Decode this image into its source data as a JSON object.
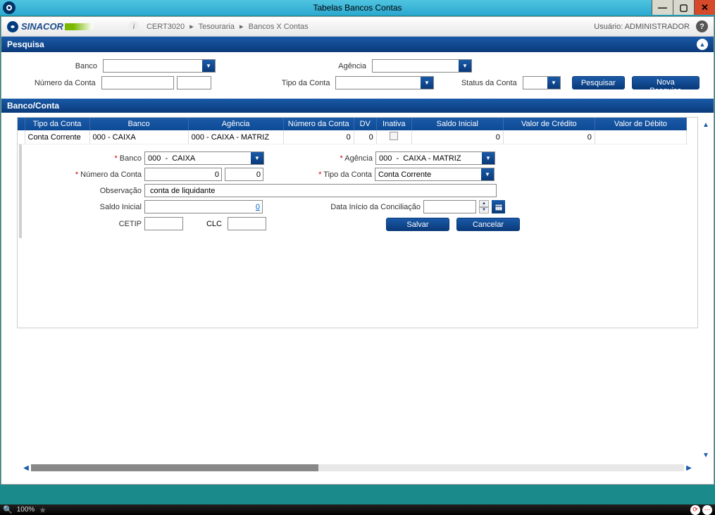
{
  "window": {
    "title": "Tabelas Bancos Contas"
  },
  "appbar": {
    "brand": "SINACOR",
    "breadcrumb": {
      "env": "CERT3020",
      "crumb1": "Tesouraria",
      "crumb2": "Bancos X Contas"
    },
    "user_label": "Usuário:",
    "user_name": "ADMINISTRADOR"
  },
  "panels": {
    "pesquisa_title": "Pesquisa",
    "bancoconta_title": "Banco/Conta"
  },
  "pesquisa": {
    "banco_label": "Banco",
    "agencia_label": "Agência",
    "numero_conta_label": "Número da Conta",
    "tipo_conta_label": "Tipo da Conta",
    "status_conta_label": "Status da Conta",
    "pesquisar_btn": "Pesquisar",
    "nova_pesquisa_btn": "Nova Pesquisa",
    "banco_value": "",
    "agencia_value": "",
    "numero_value": "",
    "dv_value": "",
    "tipo_value": "",
    "status_value": ""
  },
  "table": {
    "headers": {
      "tipo": "Tipo da Conta",
      "banco": "Banco",
      "agencia": "Agência",
      "numero": "Número da Conta",
      "dv": "DV",
      "inativa": "Inativa",
      "saldo": "Saldo Inicial",
      "credito": "Valor de Crédito",
      "debito": "Valor de Débito"
    },
    "rows": [
      {
        "tipo": "Conta Corrente",
        "banco": "000   -   CAIXA",
        "agencia": "000   -   CAIXA - MATRIZ",
        "numero": "0",
        "dv": "0",
        "inativa": false,
        "saldo": "0",
        "credito": "0",
        "debito": ""
      }
    ]
  },
  "detail": {
    "banco_label": "Banco",
    "banco_value": "000  -  CAIXA",
    "agencia_label": "Agência",
    "agencia_value": "000  -  CAIXA - MATRIZ",
    "numero_label": "Número da Conta",
    "numero_value": "0",
    "dv_value": "0",
    "tipo_label": "Tipo da Conta",
    "tipo_value": "Conta Corrente",
    "obs_label": "Observação",
    "obs_value": "conta de liquidante",
    "saldo_label": "Saldo Inicial",
    "saldo_value": "0",
    "concil_label": "Data Início da Conciliação",
    "concil_value": "",
    "cetip_label": "CETIP",
    "cetip_value": "",
    "clc_label": "CLC",
    "clc_value": "",
    "salvar_btn": "Salvar",
    "cancelar_btn": "Cancelar"
  },
  "statusbar": {
    "zoom": "100%"
  }
}
